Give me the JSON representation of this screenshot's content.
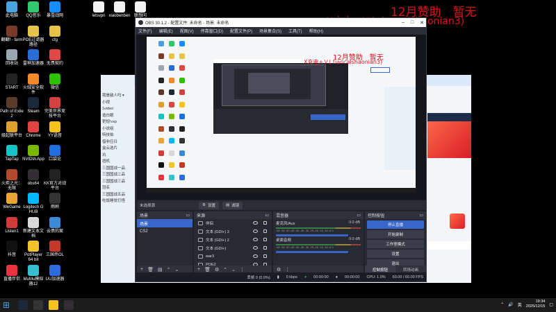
{
  "desktop": {
    "icons": [
      {
        "label": "此电脑",
        "color": "#4aa3df"
      },
      {
        "label": "QQ音乐",
        "color": "#2fc86b"
      },
      {
        "label": "暴雪战网",
        "color": "#148eff"
      },
      {
        "label": "翻翻f - farm",
        "color": "#7a3a2a"
      },
      {
        "label": "POE过滤器路径",
        "color": "#e8c34a"
      },
      {
        "label": "cfg",
        "color": "#e8c34a"
      },
      {
        "label": "回收站",
        "color": "#9aa6b2"
      },
      {
        "label": "雷神加速器",
        "color": "#2a6cd6"
      },
      {
        "label": "无畏契约",
        "color": "#e04848"
      },
      {
        "label": "START",
        "color": "#222"
      },
      {
        "label": "火绒安全软件",
        "color": "#f28a2a"
      },
      {
        "label": "微信",
        "color": "#2dc100"
      },
      {
        "label": "Path of Exile 2",
        "color": "#5a3a2a"
      },
      {
        "label": "Steam",
        "color": "#1b2838"
      },
      {
        "label": "完美世界竞技平台",
        "color": "#d24242"
      },
      {
        "label": "级起联平台",
        "color": "#e0a030"
      },
      {
        "label": "Chrome",
        "color": "#e0443e"
      },
      {
        "label": "YY语音",
        "color": "#f7c21b"
      },
      {
        "label": "TapTap",
        "color": "#16c6c6"
      },
      {
        "label": "NVIDIA App",
        "color": "#76b900"
      },
      {
        "label": "口袋论",
        "color": "#1f6fe0"
      },
      {
        "label": "火炬之光：无限",
        "color": "#b04a2a"
      },
      {
        "label": "obs64",
        "color": "#302e31"
      },
      {
        "label": "KK官方对战平台",
        "color": "#222"
      },
      {
        "label": "WeGame",
        "color": "#e8a532"
      },
      {
        "label": "Logitech G HUB",
        "color": "#00b8fc"
      },
      {
        "label": "雨刷",
        "color": "#333"
      },
      {
        "label": "Listen1",
        "color": "#d23a3a"
      },
      {
        "label": "新建文本文档",
        "color": "#d8d8d8"
      },
      {
        "label": "云债的案",
        "color": "#3a8ad8"
      },
      {
        "label": "抖音",
        "color": "#111"
      },
      {
        "label": "PotPlayer 64 bit",
        "color": "#f2c32b"
      },
      {
        "label": "三国杀OL",
        "color": "#c43a2a"
      },
      {
        "label": "直播伴侣",
        "color": "#e8343c"
      },
      {
        "label": "MuMu模拟器12",
        "color": "#36c0d0"
      },
      {
        "label": "UU加速器",
        "color": "#2d6cdf"
      }
    ],
    "top_files": [
      {
        "label": "letsvpn",
        "color": "#f2f2f2"
      },
      {
        "label": "xiaobenben",
        "color": "#f2f2f2"
      },
      {
        "label": "联想问",
        "color": "#f2f2f2"
      }
    ]
  },
  "overlay": {
    "sponsor_line": "12月赞助　暂无",
    "wechat_line": "X充电+Ｖ( tiancaishaonian3)"
  },
  "obs": {
    "title": "OBS 30.1.2 - 配置文件: 未命名 - 场景: 未命名",
    "menu": [
      "文件(F)",
      "编辑(E)",
      "视图(V)",
      "停靠窗口(D)",
      "配置文件(P)",
      "场景集合(S)",
      "工具(T)",
      "帮助(H)"
    ],
    "nested": {
      "sponsor_line": "12月赞助　暂无",
      "wechat_line": "X充电+Ｖ( tiancaishaonian3)"
    },
    "source_strip": {
      "no_source": "未选择源",
      "settings": "设置",
      "filters": "滤镜"
    },
    "scenes": {
      "title": "场景",
      "items": [
        {
          "label": "场景",
          "selected": true
        },
        {
          "label": "CS2",
          "selected": false
        }
      ]
    },
    "sources": {
      "title": "来源",
      "items": [
        "伴侣",
        "文本 (GDI+) 3",
        "文本 (GDI+) 2",
        "文本 (GDI+)",
        "war3",
        "POE2"
      ]
    },
    "mixer": {
      "title": "混音器",
      "tracks": [
        {
          "name": "麦克风/Aux",
          "db": "0.0 dB"
        },
        {
          "name": "桌面音频",
          "db": "0.0 dB"
        }
      ],
      "scale": "-60 -55 -50 -45 -40 -35 -30 -25 -20 -15 -10 -5 0"
    },
    "controls": {
      "title": "控制按钮",
      "buttons": [
        "停止直播",
        "开始录制",
        "工作室模式",
        "设置",
        "退出"
      ],
      "tabs": [
        "控制按钮",
        "转场动画"
      ]
    },
    "statusbar": {
      "dropped": "丢帧 0 (0.0%)",
      "bitrate": "0 kbps",
      "live_time": "00:00:00",
      "rec_time": "00:00:00",
      "cpu": "CPU: 1.0%",
      "fps": "60.00 / 60.00 FPS"
    }
  },
  "taskbar": {
    "time": "19:34",
    "date": "2025/12/15",
    "lang": "英",
    "pinned": [
      "windows",
      "steam",
      "kk",
      "obs-yy",
      "obs"
    ]
  }
}
